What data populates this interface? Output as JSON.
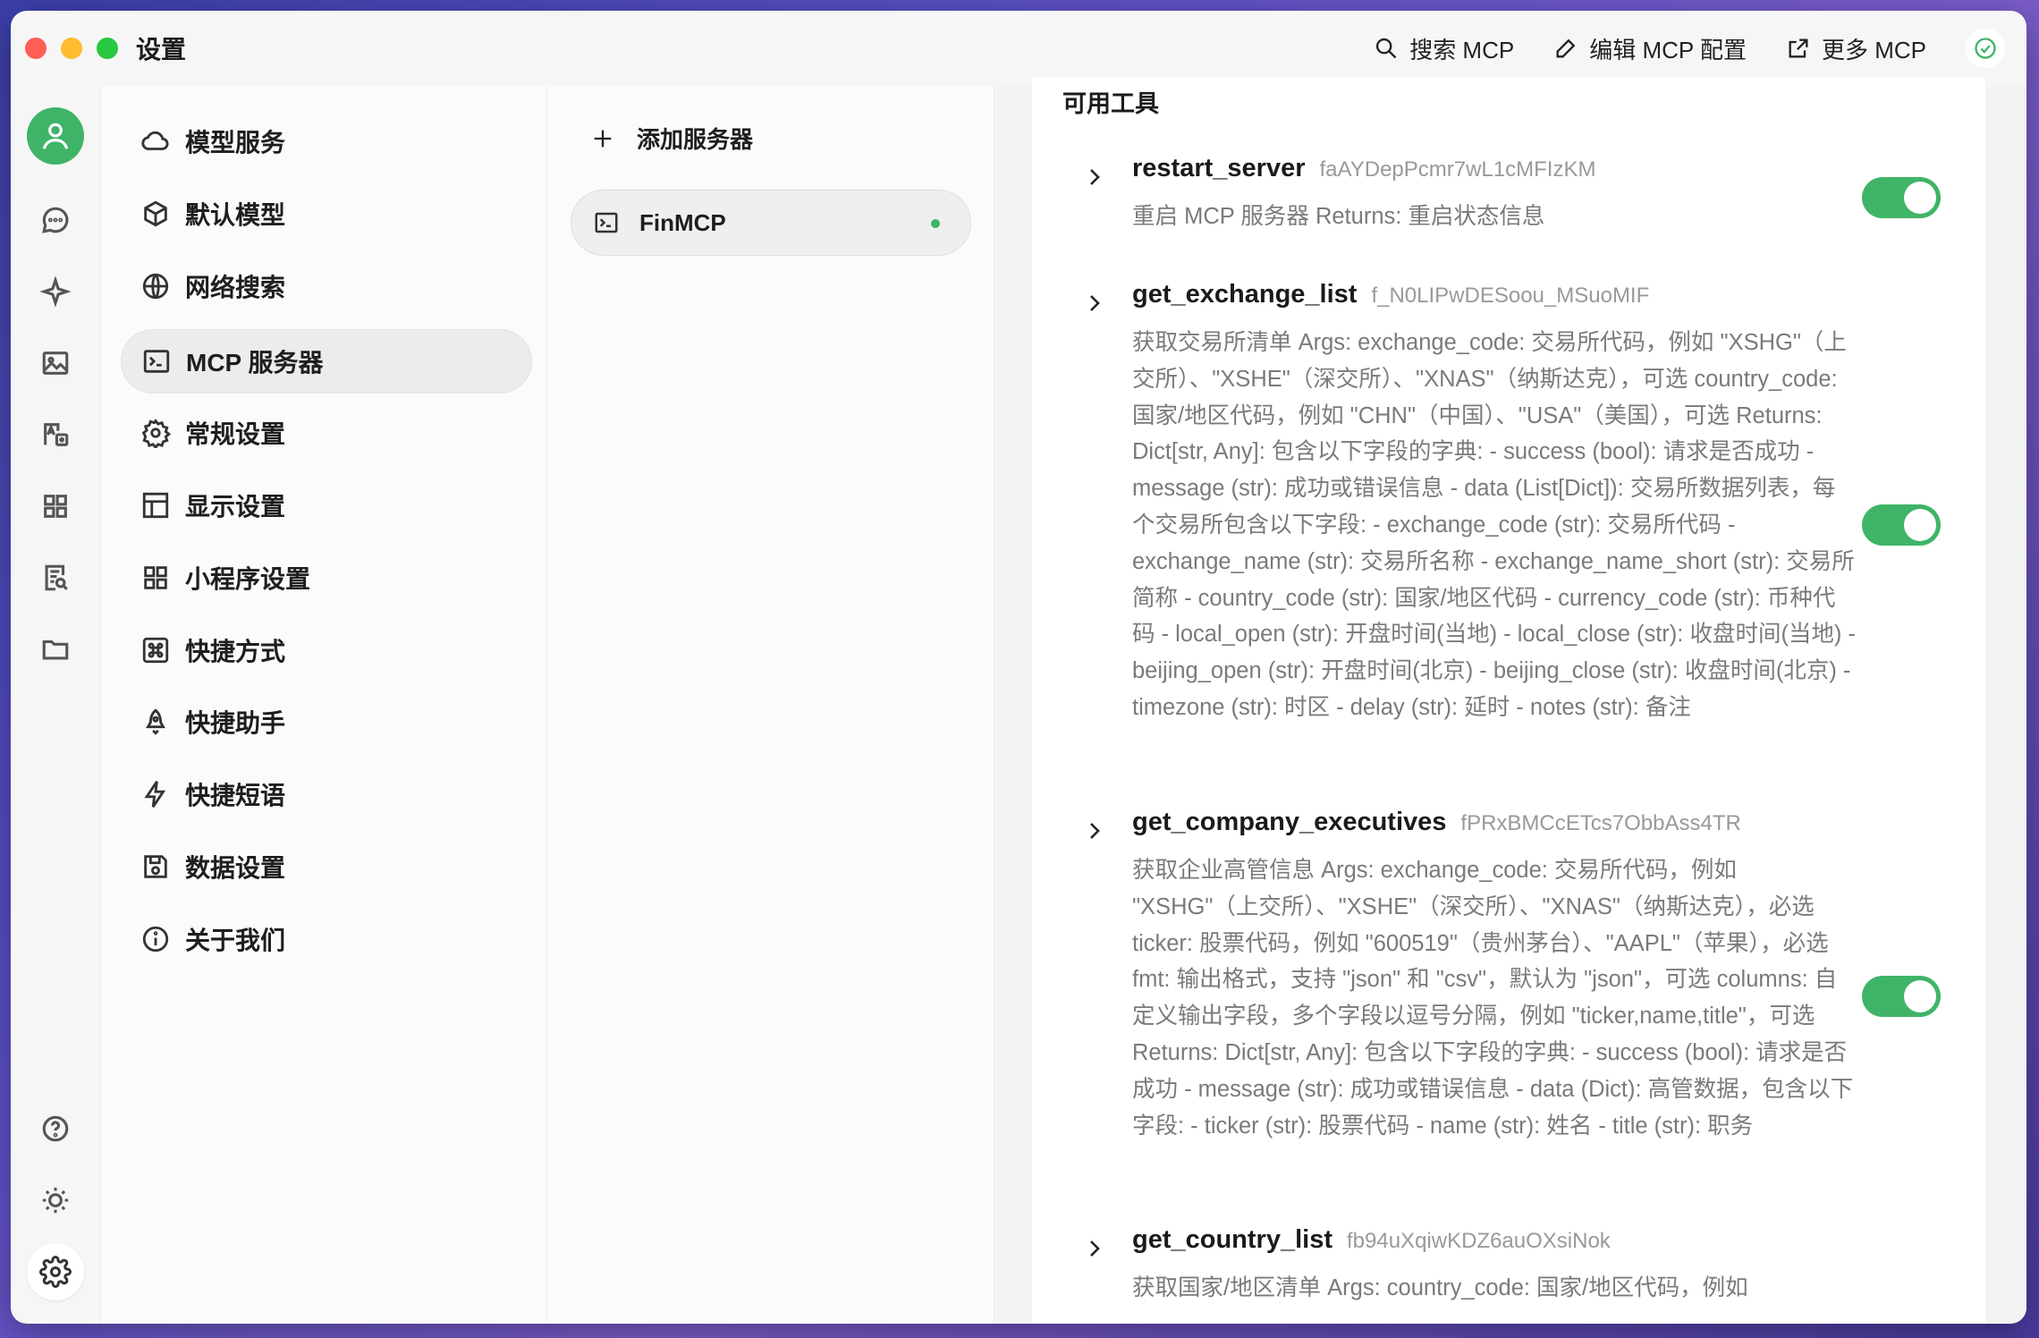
{
  "window": {
    "title": "设置"
  },
  "toolbar": {
    "search_label": "搜索 MCP",
    "edit_label": "编辑 MCP 配置",
    "more_label": "更多 MCP"
  },
  "rail": {
    "icons": [
      "user-icon",
      "chat-icon",
      "sparkle-icon",
      "image-icon",
      "translate-icon",
      "apps-icon",
      "file-search-icon",
      "folder-icon",
      "help-icon",
      "theme-icon",
      "settings-icon"
    ]
  },
  "nav": {
    "items": [
      {
        "label": "模型服务",
        "icon": "cloud-icon"
      },
      {
        "label": "默认模型",
        "icon": "cube-icon"
      },
      {
        "label": "网络搜索",
        "icon": "globe-icon"
      },
      {
        "label": "MCP 服务器",
        "icon": "terminal-icon"
      },
      {
        "label": "常规设置",
        "icon": "gear-icon"
      },
      {
        "label": "显示设置",
        "icon": "layout-icon"
      },
      {
        "label": "小程序设置",
        "icon": "grid-icon"
      },
      {
        "label": "快捷方式",
        "icon": "command-icon"
      },
      {
        "label": "快捷助手",
        "icon": "rocket-icon"
      },
      {
        "label": "快捷短语",
        "icon": "bolt-icon"
      },
      {
        "label": "数据设置",
        "icon": "save-icon"
      },
      {
        "label": "关于我们",
        "icon": "info-icon"
      }
    ],
    "active_index": 3
  },
  "servers": {
    "add_label": "添加服务器",
    "items": [
      {
        "name": "FinMCP",
        "status_color": "#3fb468"
      }
    ]
  },
  "detail": {
    "section_title": "可用工具",
    "tools": [
      {
        "name": "restart_server",
        "id": "faAYDepPcmr7wL1cMFIzKM",
        "desc": "重启 MCP 服务器 Returns: 重启状态信息",
        "enabled": true
      },
      {
        "name": "get_exchange_list",
        "id": "f_N0LIPwDESoou_MSuoMIF",
        "desc": "获取交易所清单 Args: exchange_code: 交易所代码，例如 \"XSHG\"（上交所）、\"XSHE\"（深交所）、\"XNAS\"（纳斯达克），可选 country_code: 国家/地区代码，例如 \"CHN\"（中国）、\"USA\"（美国），可选 Returns: Dict[str, Any]: 包含以下字段的字典: - success (bool): 请求是否成功 - message (str): 成功或错误信息 - data (List[Dict]): 交易所数据列表，每个交易所包含以下字段: - exchange_code (str): 交易所代码 - exchange_name (str): 交易所名称 - exchange_name_short (str): 交易所简称 - country_code (str): 国家/地区代码 - currency_code (str): 币种代码 - local_open (str): 开盘时间(当地) - local_close (str): 收盘时间(当地) - beijing_open (str): 开盘时间(北京) - beijing_close (str): 收盘时间(北京) - timezone (str): 时区 - delay (str): 延时 - notes (str): 备注",
        "enabled": true
      },
      {
        "name": "get_company_executives",
        "id": "fPRxBMCcETcs7ObbAss4TR",
        "desc": "获取企业高管信息 Args: exchange_code: 交易所代码，例如 \"XSHG\"（上交所）、\"XSHE\"（深交所）、\"XNAS\"（纳斯达克），必选 ticker: 股票代码，例如 \"600519\"（贵州茅台）、\"AAPL\"（苹果），必选 fmt: 输出格式，支持 \"json\" 和 \"csv\"，默认为 \"json\"，可选 columns: 自定义输出字段，多个字段以逗号分隔，例如 \"ticker,name,title\"，可选 Returns: Dict[str, Any]: 包含以下字段的字典: - success (bool): 请求是否成功 - message (str): 成功或错误信息 - data (Dict): 高管数据，包含以下字段: - ticker (str): 股票代码 - name (str): 姓名 - title (str): 职务",
        "enabled": true
      },
      {
        "name": "get_country_list",
        "id": "fb94uXqiwKDZ6auOXsiNok",
        "desc": "获取国家/地区清单 Args: country_code: 国家/地区代码，例如",
        "enabled": true
      }
    ]
  }
}
